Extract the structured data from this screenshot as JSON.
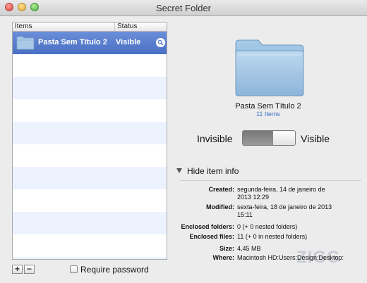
{
  "window": {
    "title": "Secret Folder"
  },
  "list": {
    "columns": {
      "items": "Items",
      "status": "Status"
    },
    "rows": [
      {
        "name": "Pasta Sem Título 2",
        "status": "Visible"
      }
    ]
  },
  "controls": {
    "add": "+",
    "remove": "−",
    "require_password": "Require password",
    "require_password_checked": false
  },
  "preview": {
    "folder_name": "Pasta Sem Título 2",
    "item_count": "11 Items"
  },
  "visibility": {
    "left_label": "Invisible",
    "right_label": "Visible",
    "state": "Visible"
  },
  "item_info": {
    "toggle_label": "Hide item info",
    "created": {
      "label": "Created:",
      "line1": "segunda-feira, 14 de janeiro de",
      "line2": "2013 12:29"
    },
    "modified": {
      "label": "Modified:",
      "line1": "sexta-feira, 18 de janeiro de 2013",
      "line2": "15:11"
    },
    "enclosed_folders": {
      "label": "Enclosed folders:",
      "value": "0 (+ 0 nested folders)"
    },
    "enclosed_files": {
      "label": "Enclosed files:",
      "value": "11 (+ 0 in nested folders)"
    },
    "size": {
      "label": "Size:",
      "value": "4,45 MB"
    },
    "where": {
      "label": "Where:",
      "value": "Macintosh HD:Users:Design:Desktop:"
    }
  },
  "watermark": "ZIGG",
  "colors": {
    "selection": "#5577cc",
    "link_blue": "#3b6fcb",
    "folder": "#8fb8dc"
  }
}
